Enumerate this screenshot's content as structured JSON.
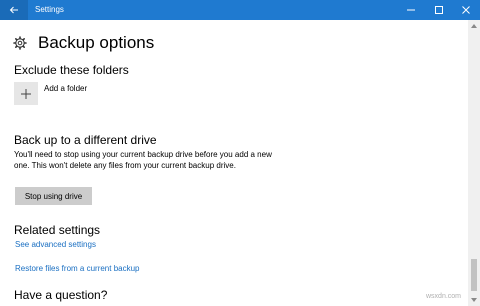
{
  "window": {
    "title": "Settings",
    "back_icon": "back-arrow-icon",
    "controls": [
      "minimize-icon",
      "maximize-icon",
      "close-icon"
    ],
    "accent_color": "#1f7ad0"
  },
  "page": {
    "title": "Backup options",
    "title_icon": "gear-icon"
  },
  "exclude": {
    "heading": "Exclude these folders",
    "add_label": "Add a folder",
    "add_icon": "plus-icon"
  },
  "drive": {
    "heading": "Back up to a different drive",
    "description": "You'll need to stop using your current backup drive before you add a new one. This won't delete any files from your current backup drive.",
    "button_label": "Stop using drive"
  },
  "related": {
    "heading": "Related settings",
    "links": [
      "See advanced settings",
      "Restore files from a current backup"
    ],
    "link_color": "#1a6fc2"
  },
  "question": {
    "heading": "Have a question?"
  },
  "watermark": "wsxdn.com"
}
